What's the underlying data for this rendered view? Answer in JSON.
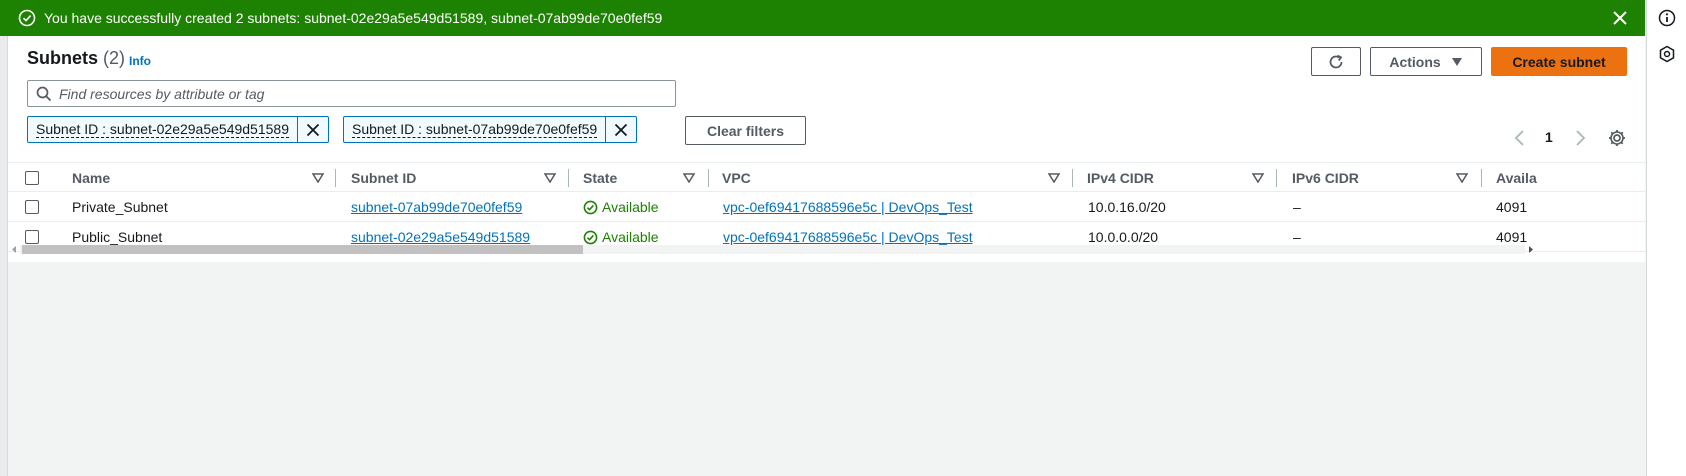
{
  "banner": {
    "message": "You have successfully created 2 subnets: subnet-02e29a5e549d51589, subnet-07ab99de70e0fef59",
    "color": "#1d8102"
  },
  "header": {
    "title": "Subnets",
    "count": "(2)",
    "info": "Info",
    "actions_label": "Actions",
    "create_label": "Create subnet"
  },
  "search": {
    "placeholder": "Find resources by attribute or tag"
  },
  "filters": [
    {
      "label": "Subnet ID : subnet-02e29a5e549d51589"
    },
    {
      "label": "Subnet ID : subnet-07ab99de70e0fef59"
    }
  ],
  "clear_filters": "Clear filters",
  "pagination": {
    "page": "1"
  },
  "table": {
    "columns": [
      "Name",
      "Subnet ID",
      "State",
      "VPC",
      "IPv4 CIDR",
      "IPv6 CIDR",
      "Availa"
    ],
    "rows": [
      {
        "name": "Private_Subnet",
        "subnet_id": "subnet-07ab99de70e0fef59",
        "state": "Available",
        "vpc": "vpc-0ef69417688596e5c | DevOps_Test",
        "ipv4": "10.0.16.0/20",
        "ipv6": "–",
        "avail": "4091"
      },
      {
        "name": "Public_Subnet",
        "subnet_id": "subnet-02e29a5e549d51589",
        "state": "Available",
        "vpc": "vpc-0ef69417688596e5c | DevOps_Test",
        "ipv4": "10.0.0.0/20",
        "ipv6": "–",
        "avail": "4091"
      }
    ]
  },
  "colors": {
    "accent": "#ec7211",
    "link": "#0073bb",
    "success": "#1d8102"
  },
  "icons": [
    "success-check-icon",
    "close-icon",
    "info-circle-icon",
    "hexagon-icon",
    "refresh-icon",
    "caret-down-icon",
    "search-icon",
    "chevron-left-icon",
    "chevron-right-icon",
    "gear-icon",
    "sort-icon"
  ]
}
